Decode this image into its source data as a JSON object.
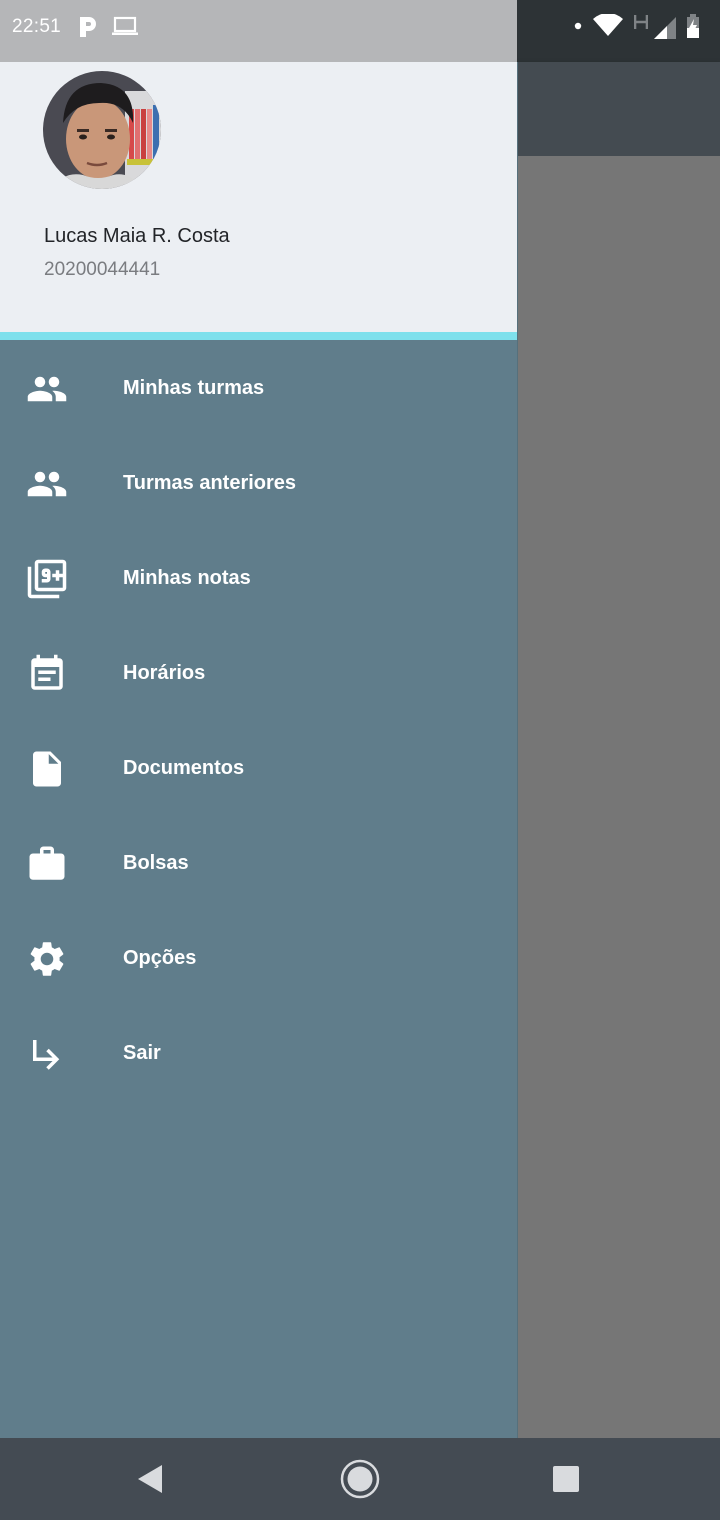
{
  "status_bar": {
    "time": "22:51",
    "icons": [
      "p-notification-icon",
      "laptop-icon",
      "dot-icon",
      "wifi-icon",
      "h-network-icon",
      "signal-icon",
      "battery-charging-icon"
    ]
  },
  "user": {
    "name": "Lucas Maia R. Costa",
    "id": "20200044441"
  },
  "menu": {
    "items": [
      {
        "label": "Minhas turmas",
        "icon": "group-icon"
      },
      {
        "label": "Turmas anteriores",
        "icon": "group-icon"
      },
      {
        "label": "Minhas notas",
        "icon": "filter-9-plus-icon"
      },
      {
        "label": "Horários",
        "icon": "calendar-note-icon"
      },
      {
        "label": "Documentos",
        "icon": "document-icon"
      },
      {
        "label": "Bolsas",
        "icon": "briefcase-icon"
      },
      {
        "label": "Opções",
        "icon": "gear-icon"
      },
      {
        "label": "Sair",
        "icon": "exit-arrow-icon"
      }
    ]
  },
  "nav_bar": {
    "buttons": [
      "back-icon",
      "home-icon",
      "recents-icon"
    ]
  },
  "colors": {
    "drawer": "#607d8b",
    "header": "#eceff3",
    "accent": "#7ee0ec",
    "app_bar": "#444b51",
    "scrim": "#767676"
  }
}
